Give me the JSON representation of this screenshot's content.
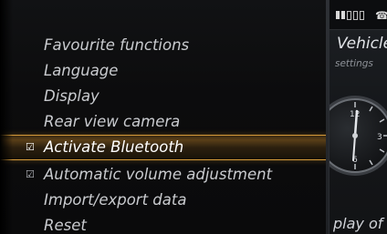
{
  "menu": {
    "items": [
      {
        "label": "Favourite functions",
        "checked": false,
        "selected": false
      },
      {
        "label": "Language",
        "checked": false,
        "selected": false
      },
      {
        "label": "Display",
        "checked": false,
        "selected": false
      },
      {
        "label": "Rear view camera",
        "checked": false,
        "selected": false
      },
      {
        "label": "Activate Bluetooth",
        "checked": true,
        "selected": true
      },
      {
        "label": "Automatic volume adjustment",
        "checked": true,
        "selected": false
      },
      {
        "label": "Import/export data",
        "checked": false,
        "selected": false
      },
      {
        "label": "Reset",
        "checked": false,
        "selected": false
      }
    ],
    "check_glyph": "☑"
  },
  "right_panel": {
    "title": "Vehicle",
    "subtitle": "settings",
    "bottom_text": "play of",
    "phone_glyph": "☎",
    "clock_numbers": [
      "12",
      "3",
      "6",
      "9"
    ]
  },
  "colors": {
    "accent": "#d49a3a",
    "text": "#c9cbcf",
    "selected_text": "#ffffff"
  }
}
